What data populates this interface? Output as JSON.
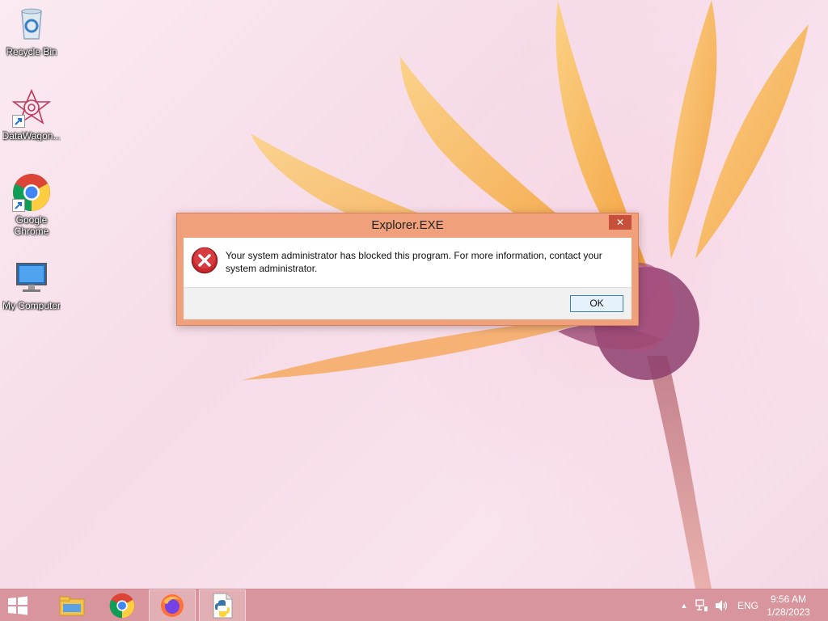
{
  "desktop": {
    "icons": [
      {
        "label": "Recycle Bin"
      },
      {
        "label": "DataWagon..."
      },
      {
        "label": "Google Chrome"
      },
      {
        "label": "My Computer"
      }
    ]
  },
  "dialog": {
    "title": "Explorer.EXE",
    "close_glyph": "✕",
    "message": "Your system administrator has blocked this program. For more information, contact your system administrator.",
    "ok_label": "OK",
    "icon": "error-icon"
  },
  "taskbar": {
    "apps": [
      {
        "icon": "file-explorer-icon"
      },
      {
        "icon": "chrome-icon"
      },
      {
        "icon": "firefox-icon"
      },
      {
        "icon": "python-file-icon"
      }
    ],
    "tray": {
      "show_hidden_glyph": "▲",
      "language": "ENG",
      "time": "9:56 AM",
      "date": "1/28/2023"
    }
  },
  "colors": {
    "dialog_frame": "#f0a07a",
    "close_button": "#c7503a",
    "taskbar": "#d9959d",
    "petal": "#f6a93a"
  }
}
